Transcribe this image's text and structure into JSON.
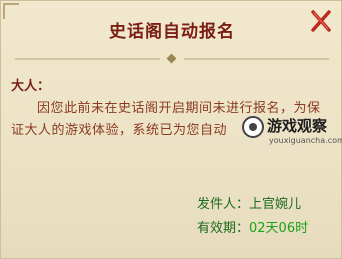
{
  "dialog": {
    "title": "史话阁自动报名"
  },
  "message": {
    "greeting": "大人：",
    "body": "因您此前未在史话阁开启期间未进行报名，为保证大人的游戏体验，系统已为您自动",
    "sender_label": "发件人：",
    "sender_name": "上官婉儿",
    "validity_label": "有效期：",
    "validity_value": "02天06时"
  },
  "watermark": {
    "brand": "游戏观察",
    "url": "youxiguancha.com"
  },
  "colors": {
    "title": "#7a1e14",
    "body_text": "#8a3a22",
    "sender_text": "#1d6a1d",
    "validity_value": "#1aa31a",
    "close_icon": "#c0281e"
  }
}
